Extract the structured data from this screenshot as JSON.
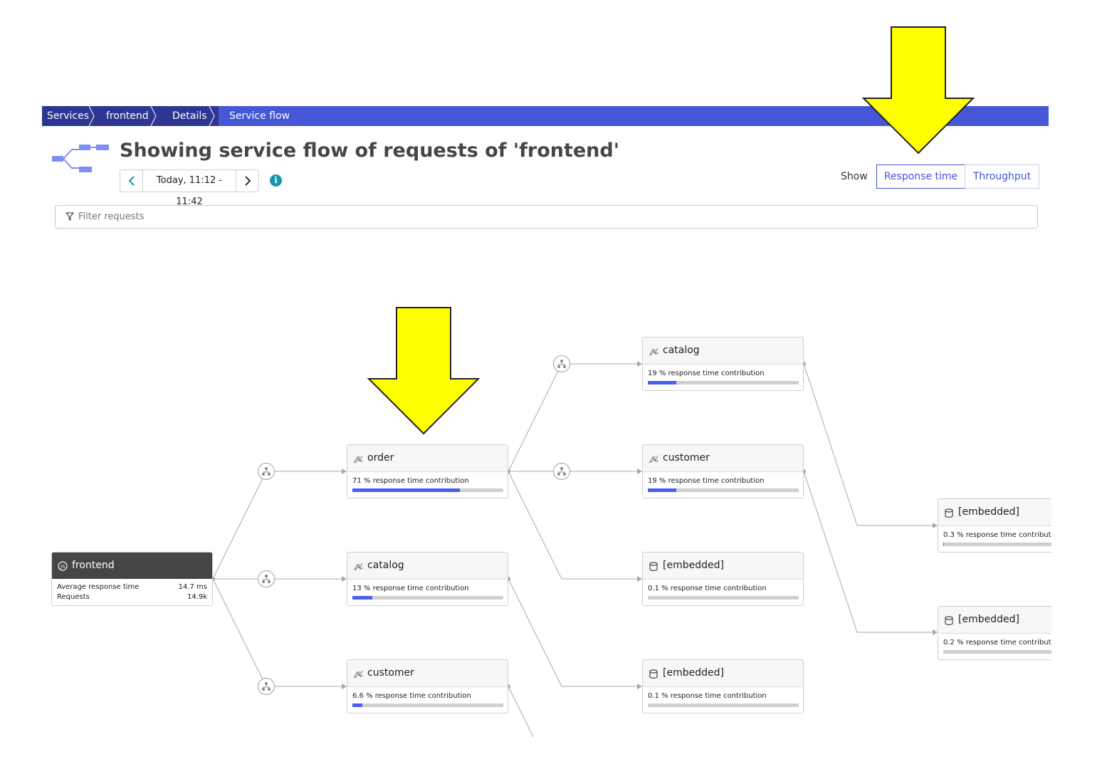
{
  "breadcrumb": [
    {
      "label": "Services"
    },
    {
      "label": "frontend"
    },
    {
      "label": "Details"
    },
    {
      "label": "Service flow"
    }
  ],
  "header": {
    "title": "Showing service flow of requests of 'frontend'",
    "timeframe": "Today, 11:12 - 11:42",
    "show_label": "Show",
    "toggle": [
      {
        "label": "Response time",
        "active": true
      },
      {
        "label": "Throughput",
        "active": false
      }
    ]
  },
  "filter": {
    "placeholder": "Filter requests"
  },
  "colors": {
    "accent": "#4556d7",
    "breadcrumb_dark": "#2e3592",
    "bar_fill": "#4a5ef2",
    "annotation_arrow": "#ffff00"
  },
  "flow": {
    "root": {
      "name": "frontend",
      "icon": "nodejs-icon",
      "avg_label": "Average response time",
      "avg_value": "14.7 ms",
      "req_label": "Requests",
      "req_value": "14.9k"
    },
    "nodes": [
      {
        "name": "order",
        "icon": "service-icon",
        "contribution": "71 % response time contribution",
        "fraction": 0.71
      },
      {
        "name": "catalog",
        "icon": "service-icon",
        "contribution": "13 % response time contribution",
        "fraction": 0.13
      },
      {
        "name": "customer",
        "icon": "service-icon",
        "contribution": "6.6 % response time contribution",
        "fraction": 0.066
      },
      {
        "name": "catalog",
        "icon": "service-icon",
        "contribution": "19 % response time contribution",
        "fraction": 0.19
      },
      {
        "name": "customer",
        "icon": "service-icon",
        "contribution": "19 % response time contribution",
        "fraction": 0.19
      },
      {
        "name": "[embedded]",
        "icon": "database-icon",
        "contribution": "0.1 % response time contribution",
        "fraction": 0.001
      },
      {
        "name": "[embedded]",
        "icon": "database-icon",
        "contribution": "0.1 % response time contribution",
        "fraction": 0.001
      },
      {
        "name": "[embedded]",
        "icon": "database-icon",
        "contribution": "0.3 % response time contribut",
        "fraction": 0.003
      },
      {
        "name": "[embedded]",
        "icon": "database-icon",
        "contribution": "0.2 % response time contribut",
        "fraction": 0.002
      }
    ]
  }
}
